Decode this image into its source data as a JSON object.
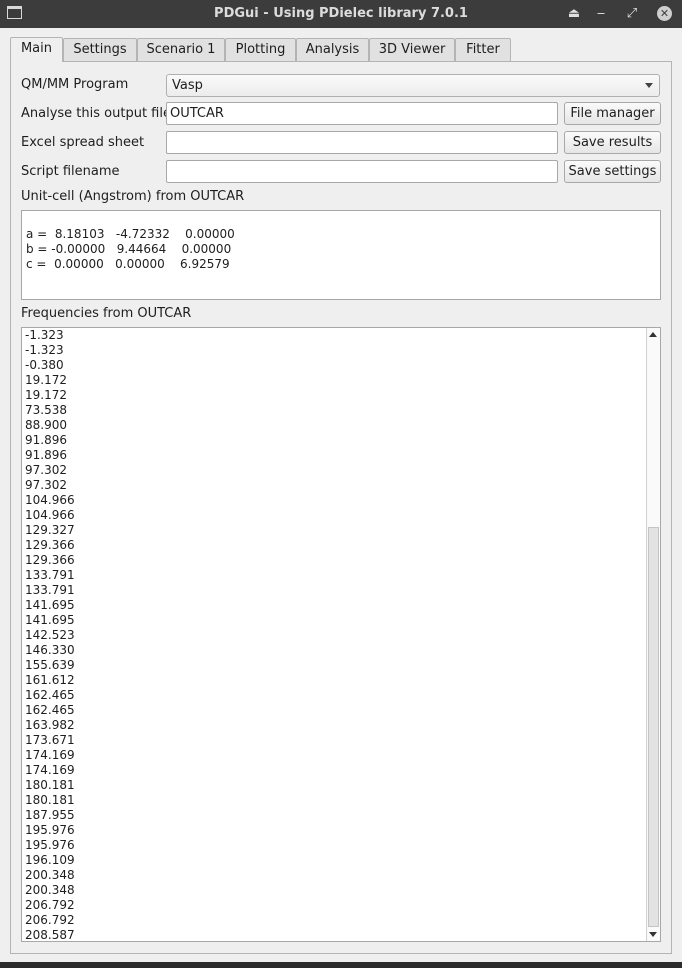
{
  "window": {
    "title": "PDGui - Using PDielec library 7.0.1",
    "icons": [
      "app-icon",
      "shade-icon",
      "minimize-icon",
      "maximize-icon",
      "close-icon"
    ],
    "glyphs": {
      "shade": "⏏",
      "minimize": "‒",
      "maximize": "⤢",
      "close": "✕"
    }
  },
  "tabs": [
    "Main",
    "Settings",
    "Scenario 1",
    "Plotting",
    "Analysis",
    "3D Viewer",
    "Fitter"
  ],
  "main": {
    "program_label": "QM/MM Program",
    "program_value": "Vasp",
    "output_label": "Analyse this output file",
    "output_value": "OUTCAR",
    "file_manager_button": "File manager",
    "excel_label": "Excel spread sheet",
    "excel_value": "",
    "save_results_button": "Save results",
    "script_label": "Script filename",
    "script_value": "",
    "save_settings_button": "Save settings",
    "unitcell_label": "Unit-cell (Angstrom) from OUTCAR",
    "unitcell_lines": [
      "a =  8.18103   -4.72332    0.00000",
      "b = -0.00000   9.44664    0.00000",
      "c =  0.00000   0.00000    6.92579"
    ],
    "frequencies_label": "Frequencies from OUTCAR",
    "frequencies": [
      "-1.323",
      "-1.323",
      "-0.380",
      "19.172",
      "19.172",
      "73.538",
      "88.900",
      "91.896",
      "91.896",
      "97.302",
      "97.302",
      "104.966",
      "104.966",
      "129.327",
      "129.366",
      "129.366",
      "133.791",
      "133.791",
      "141.695",
      "141.695",
      "142.523",
      "146.330",
      "155.639",
      "161.612",
      "162.465",
      "162.465",
      "163.982",
      "173.671",
      "174.169",
      "174.169",
      "180.181",
      "180.181",
      "187.955",
      "195.976",
      "195.976",
      "196.109",
      "200.348",
      "200.348",
      "206.792",
      "206.792",
      "208.587"
    ]
  }
}
